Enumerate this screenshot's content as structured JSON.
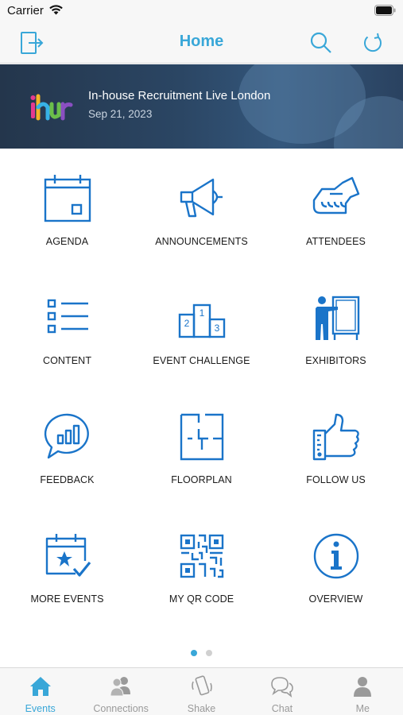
{
  "status_bar": {
    "carrier": "Carrier"
  },
  "nav": {
    "title": "Home"
  },
  "banner": {
    "title": "In-house Recruitment Live London",
    "date": "Sep 21, 2023"
  },
  "tiles": [
    {
      "label": "AGENDA",
      "icon": "calendar-icon"
    },
    {
      "label": "ANNOUNCEMENTS",
      "icon": "megaphone-icon"
    },
    {
      "label": "ATTENDEES",
      "icon": "handshake-icon"
    },
    {
      "label": "CONTENT",
      "icon": "list-icon"
    },
    {
      "label": "EVENT CHALLENGE",
      "icon": "podium-icon"
    },
    {
      "label": "EXHIBITORS",
      "icon": "presenter-icon"
    },
    {
      "label": "FEEDBACK",
      "icon": "chart-bubble-icon"
    },
    {
      "label": "FLOORPLAN",
      "icon": "floorplan-icon"
    },
    {
      "label": "FOLLOW US",
      "icon": "thumbs-up-icon"
    },
    {
      "label": "MORE EVENTS",
      "icon": "calendar-star-icon"
    },
    {
      "label": "MY QR CODE",
      "icon": "qr-code-icon"
    },
    {
      "label": "OVERVIEW",
      "icon": "info-icon"
    }
  ],
  "pager": {
    "pages": 2,
    "current": 1
  },
  "tabs": [
    {
      "label": "Events",
      "icon": "home-icon",
      "active": true
    },
    {
      "label": "Connections",
      "icon": "people-icon",
      "active": false
    },
    {
      "label": "Shake",
      "icon": "phone-shake-icon",
      "active": false
    },
    {
      "label": "Chat",
      "icon": "chat-bubbles-icon",
      "active": false
    },
    {
      "label": "Me",
      "icon": "person-icon",
      "active": false
    }
  ],
  "colors": {
    "accent": "#39a7d8",
    "icon_blue": "#1a74c9",
    "tab_inactive": "#9a9a9a"
  }
}
